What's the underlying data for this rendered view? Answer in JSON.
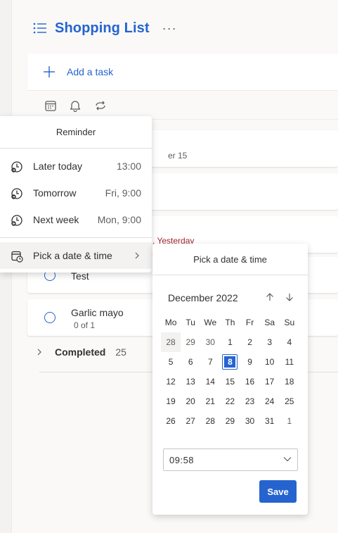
{
  "header": {
    "title": "Shopping List",
    "more": "···"
  },
  "add_task": {
    "label": "Add a task"
  },
  "tasks": [
    {
      "name": "",
      "sub": "er 15"
    },
    {
      "name": "",
      "sub": ""
    },
    {
      "name": "",
      "sub": ", Yesterday"
    },
    {
      "name": "Test",
      "sub": ""
    },
    {
      "name": "Garlic mayo",
      "sub": "0 of 1"
    }
  ],
  "completed": {
    "label": "Completed",
    "count": "25"
  },
  "reminder_menu": {
    "title": "Reminder",
    "items": [
      {
        "label": "Later today",
        "time": "13:00"
      },
      {
        "label": "Tomorrow",
        "time": "Fri, 9:00"
      },
      {
        "label": "Next week",
        "time": "Mon, 9:00"
      }
    ],
    "pick_label": "Pick a date & time"
  },
  "date_picker": {
    "title": "Pick a date & time",
    "month": "December 2022",
    "weekdays": [
      "Mo",
      "Tu",
      "We",
      "Th",
      "Fr",
      "Sa",
      "Su"
    ],
    "weeks": [
      [
        "28",
        "29",
        "30",
        "1",
        "2",
        "3",
        "4"
      ],
      [
        "5",
        "6",
        "7",
        "8",
        "9",
        "10",
        "11"
      ],
      [
        "12",
        "13",
        "14",
        "15",
        "16",
        "17",
        "18"
      ],
      [
        "19",
        "20",
        "21",
        "22",
        "23",
        "24",
        "25"
      ],
      [
        "26",
        "27",
        "28",
        "29",
        "30",
        "31",
        "1"
      ]
    ],
    "time_value": "09:58",
    "save_label": "Save"
  },
  "colors": {
    "accent": "#2564cf",
    "overdue": "#a4262c"
  }
}
